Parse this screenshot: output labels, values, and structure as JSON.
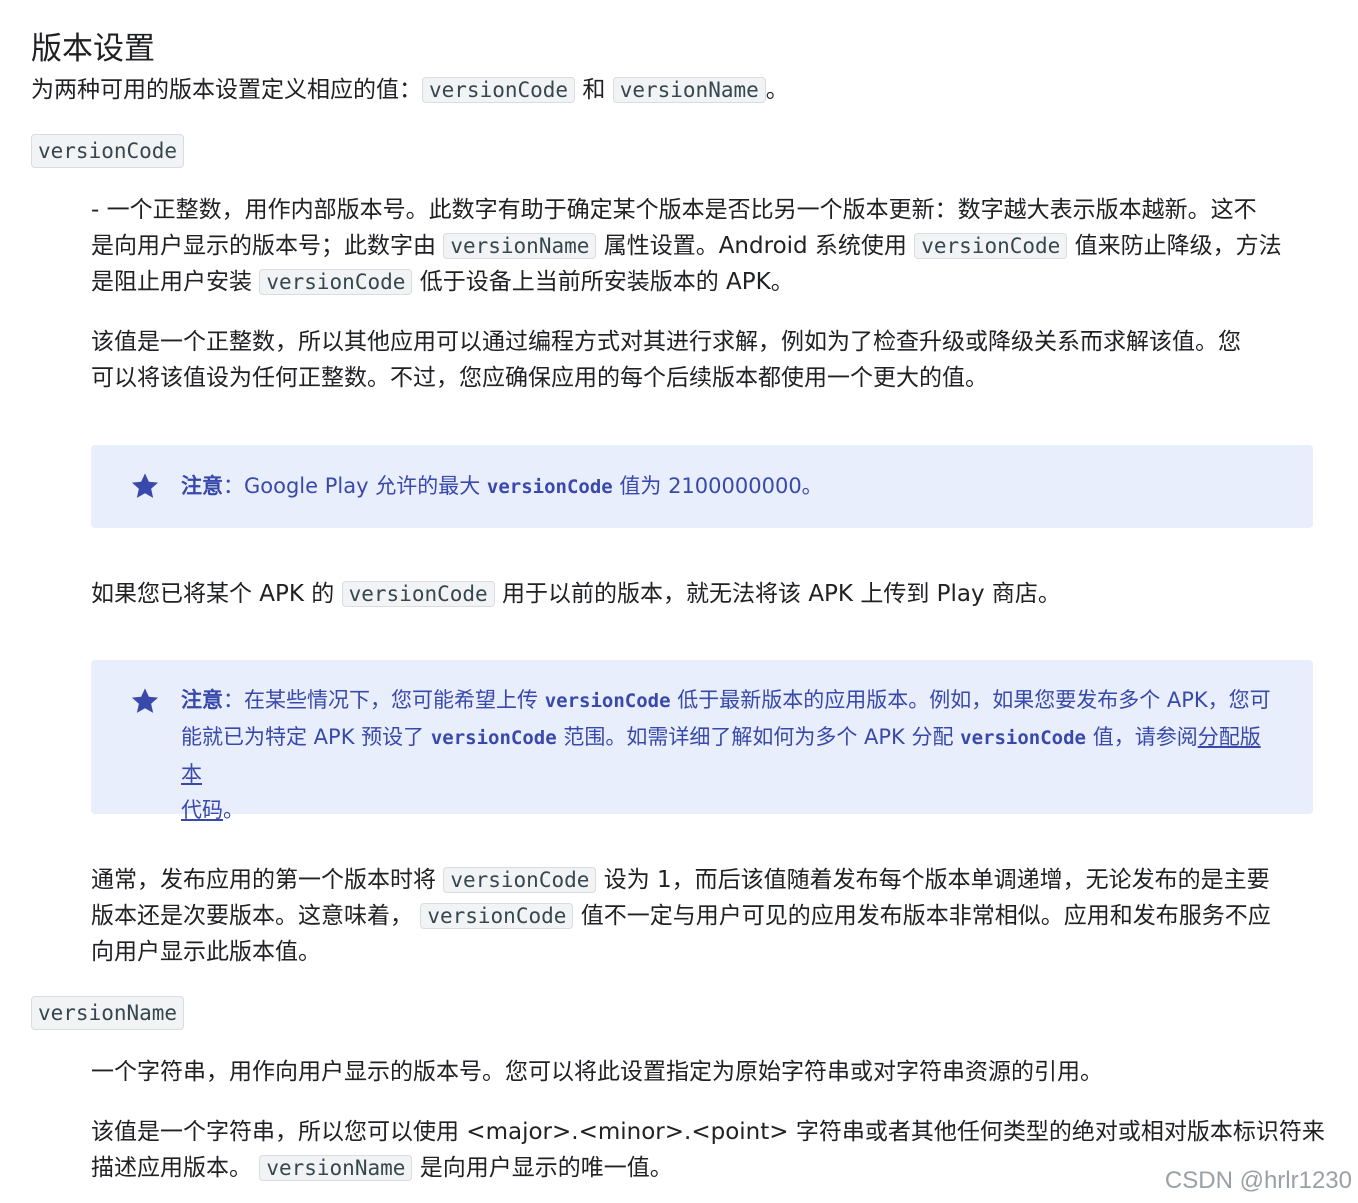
{
  "title": "版本设置",
  "intro": {
    "text1": "为两种可用的版本设置定义相应的值：",
    "code1": "versionCode",
    "text2": " 和 ",
    "code2": "versionName",
    "text3": "。"
  },
  "version_code": {
    "term": "versionCode",
    "desc": {
      "l1": "- 一个正整数，用作内部版本号。此数字有助于确定某个版本是否比另一个版本更新：数字越大表示版本越新。这不",
      "l2a": "是向用户显示的版本号；此数字由 ",
      "l2code": "versionName",
      "l2b": " 属性设置。Android 系统使用 ",
      "l2code2": "versionCode",
      "l2c": " 值来防止降级，方法",
      "l3a": "是阻止用户安装 ",
      "l3code": "versionCode",
      "l3b": " 低于设备上当前所安装版本的 APK。"
    },
    "para2": {
      "l1": "该值是一个正整数，所以其他应用可以通过编程方式对其进行求解，例如为了检查升级或降级关系而求解该值。您",
      "l2": "可以将该值设为任何正整数。不过，您应确保应用的每个后续版本都使用一个更大的值。"
    },
    "note1": {
      "label": "注意",
      "sep": "：",
      "text_a": "Google Play 允许的最大 ",
      "code": "versionCode",
      "text_b": " 值为 2100000000。"
    },
    "para3": {
      "a": "如果您已将某个 APK 的 ",
      "code": "versionCode",
      "b": " 用于以前的版本，就无法将该 APK 上传到 Play 商店。"
    },
    "note2": {
      "label": "注意",
      "sep": "：",
      "l1a": "在某些情况下，您可能希望上传 ",
      "l1code": "versionCode",
      "l1b": " 低于最新版本的应用版本。例如，如果您要发布多个 APK，您可",
      "l2a": "能就已为特定 APK 预设了 ",
      "l2code": "versionCode",
      "l2b": " 范围。如需详细了解如何为多个 APK 分配 ",
      "l2code2": "versionCode",
      "l2c": " 值，请参阅",
      "link1": "分配版本",
      "link2": "代码",
      "end": "。"
    },
    "para4": {
      "l1a": "通常，发布应用的第一个版本时将 ",
      "l1code": "versionCode",
      "l1b": " 设为 1，而后该值随着发布每个版本单调递增，无论发布的是主要",
      "l2a": "版本还是次要版本。这意味着， ",
      "l2code": "versionCode",
      "l2b": " 值不一定与用户可见的应用发布版本非常相似。应用和发布服务不应",
      "l3": "向用户显示此版本值。"
    }
  },
  "version_name": {
    "term": "versionName",
    "desc": "一个字符串，用作向用户显示的版本号。您可以将此设置指定为原始字符串或对字符串资源的引用。",
    "para2": {
      "l1": "该值是一个字符串，所以您可以使用 <major>.<minor>.<point> 字符串或者其他任何类型的绝对或相对版本标识符来",
      "l2a": "描述应用版本。 ",
      "l2code": "versionName",
      "l2b": " 是向用户显示的唯一值。"
    }
  },
  "watermark": "CSDN @hrlr1230",
  "colors": {
    "note_bg": "#e8eefc",
    "note_text": "#3949ab",
    "code_bg": "#f1f3f4"
  }
}
